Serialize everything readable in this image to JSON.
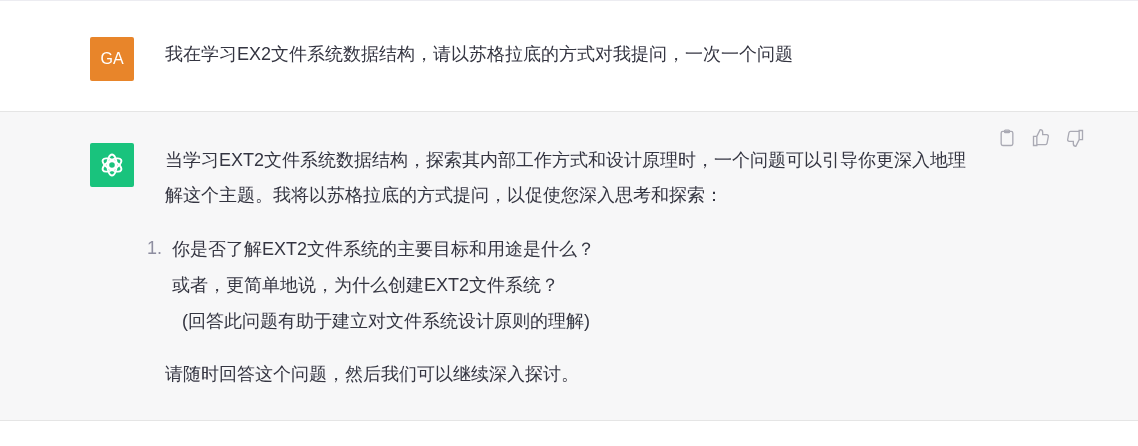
{
  "messages": [
    {
      "kind": "user",
      "avatar": "GA",
      "paragraphs": [
        "我在学习EX2文件系统数据结构，请以苏格拉底的方式对我提问，一次一个问题"
      ]
    },
    {
      "kind": "assistant",
      "paragraphs": [
        "当学习EXT2文件系统数据结构，探索其内部工作方式和设计原理时，一个问题可以引导你更深入地理解这个主题。我将以苏格拉底的方式提问，以促使您深入思考和探索："
      ],
      "list": [
        {
          "number": "1.",
          "lines": [
            "你是否了解EXT2文件系统的主要目标和用途是什么？",
            "或者，更简单地说，为什么创建EXT2文件系统？",
            "  (回答此问题有助于建立对文件系统设计原则的理解)"
          ]
        }
      ],
      "closing": "请随时回答这个问题，然后我们可以继续深入探讨。"
    }
  ]
}
